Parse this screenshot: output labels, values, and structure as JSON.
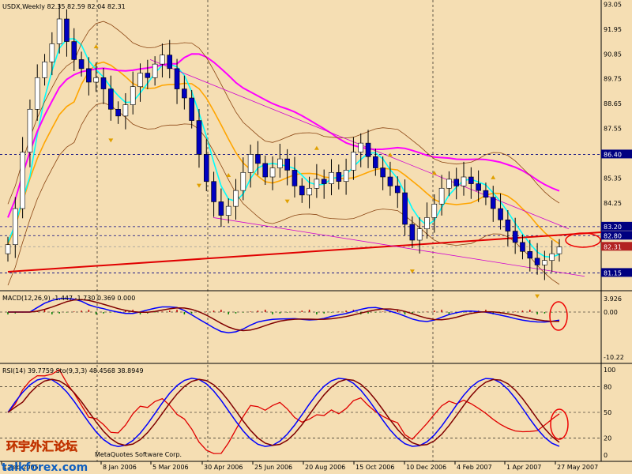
{
  "header": {
    "symbol_line": "USDX,Weekly  82.35 82.59 82.04 82.31"
  },
  "price_panel": {
    "y_labels": [
      "93.05",
      "91.95",
      "90.85",
      "89.75",
      "88.65",
      "87.55",
      "85.35",
      "84.25",
      "82.80",
      "81.15"
    ],
    "level_tags": [
      {
        "text": "86.40",
        "bg": "#000080"
      },
      {
        "text": "83.20",
        "bg": "#000080"
      },
      {
        "text": "82.80",
        "bg": "#000080"
      },
      {
        "text": "82.31",
        "bg": "#b22222"
      },
      {
        "text": "81.15",
        "bg": "#000080"
      }
    ],
    "ylim": [
      80.5,
      93.1
    ]
  },
  "macd_panel": {
    "label": "MACD(12,26,9) -1.447 -1.730 0.369 0.000",
    "y_labels": [
      "3.926",
      "0.00",
      "-10.22"
    ]
  },
  "rsi_panel": {
    "label": "RSI(14) 39.7759  Sto(9,3,3) 48.4568 38.8949",
    "y_labels": [
      "100",
      "80",
      "50",
      "20",
      "0"
    ]
  },
  "x_labels": [
    "1 Feb 2005",
    "8 Jan 2006",
    "5 Mar 2006",
    "30 Apr 2006",
    "25 Jun 2006",
    "20 Aug 2006",
    "15 Oct 2006",
    "10 Dec 2006",
    "4 Feb 2007",
    "1 Apr 2007",
    "27 May 2007"
  ],
  "watermark": {
    "text": "talkforex.com",
    "chinese": "环宇外汇论坛",
    "copyright": "MetaQuotes Software Corp."
  },
  "chart_data": {
    "type": "candlestick",
    "title": "USDX,Weekly",
    "ohlc_last": {
      "open": 82.35,
      "high": 82.59,
      "low": 82.04,
      "close": 82.31
    },
    "closes": [
      82.4,
      84.0,
      86.5,
      88.4,
      89.8,
      90.5,
      91.3,
      92.4,
      91.4,
      90.6,
      90.2,
      89.6,
      89.8,
      89.3,
      88.4,
      88.1,
      88.6,
      89.4,
      90.0,
      89.8,
      90.4,
      90.8,
      90.2,
      89.3,
      88.9,
      87.9,
      86.4,
      85.2,
      84.3,
      83.7,
      84.1,
      84.8,
      85.6,
      86.4,
      86.0,
      85.4,
      85.8,
      86.2,
      85.7,
      85.0,
      84.6,
      84.9,
      85.3,
      85.1,
      85.6,
      85.2,
      85.7,
      86.5,
      86.9,
      86.3,
      85.8,
      85.4,
      85.0,
      84.7,
      83.3,
      82.6,
      83.1,
      83.6,
      84.2,
      84.9,
      85.3,
      85.0,
      85.4,
      85.1,
      84.8,
      84.5,
      84.0,
      83.5,
      83.0,
      82.5,
      82.1,
      81.8,
      81.5,
      81.7,
      82.0,
      82.3
    ],
    "levels": [
      86.4,
      83.2,
      82.8,
      82.31,
      81.15
    ],
    "macd": {
      "main": -1.447,
      "signal": -1.73,
      "osma": 0.369
    },
    "rsi": 39.7759,
    "stochastic": {
      "k": 48.4568,
      "d": 38.8949
    }
  }
}
